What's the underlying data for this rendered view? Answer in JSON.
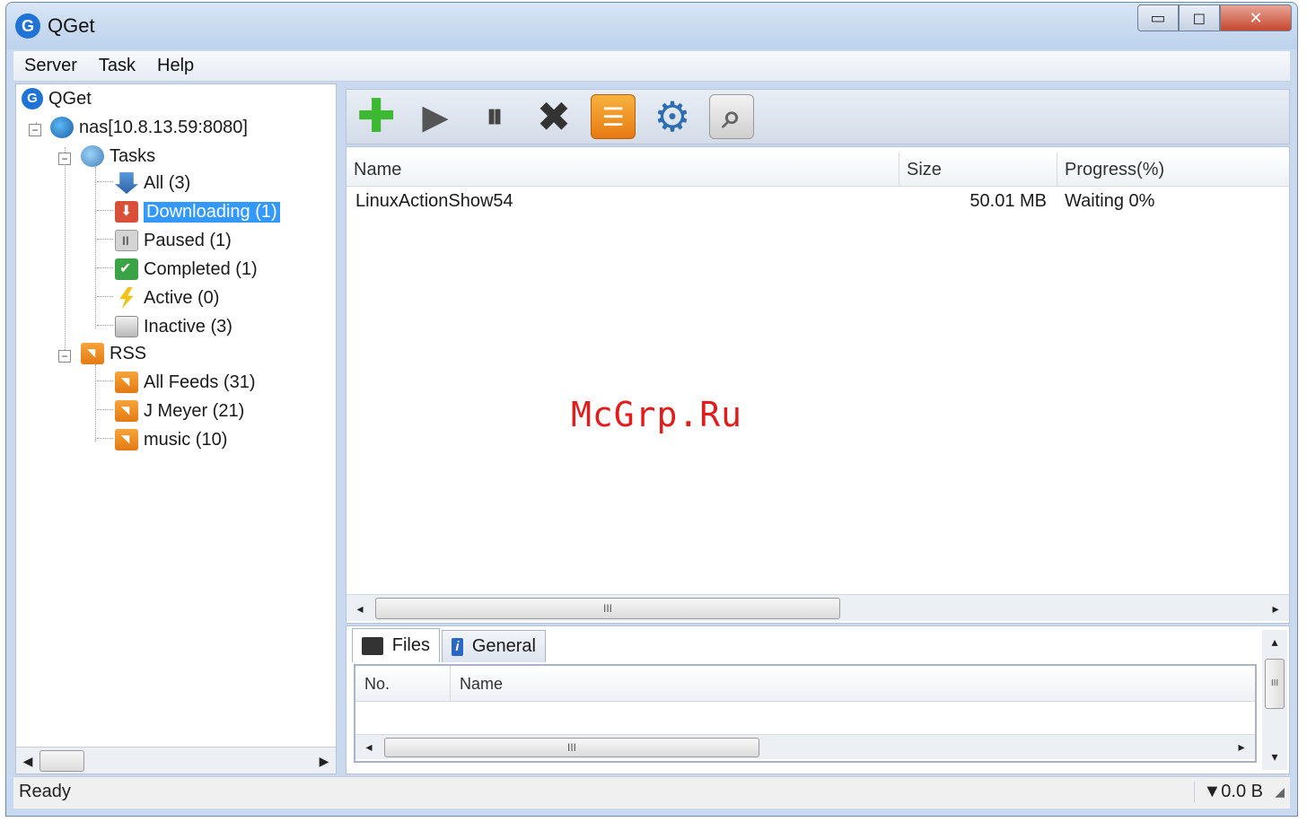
{
  "window": {
    "title": "QGet",
    "min_glyph": "▭",
    "max_glyph": "◻",
    "close_glyph": "✕"
  },
  "menu": [
    "Server",
    "Task",
    "Help"
  ],
  "tree": {
    "root": "QGet",
    "server": "nas[10.8.13.59:8080]",
    "tasks": "Tasks",
    "task_items": [
      {
        "label": "All (3)",
        "icon": "download-all-icon"
      },
      {
        "label": "Downloading (1)",
        "icon": "downloading-icon",
        "selected": true
      },
      {
        "label": "Paused (1)",
        "icon": "paused-icon"
      },
      {
        "label": "Completed (1)",
        "icon": "completed-icon"
      },
      {
        "label": "Active (0)",
        "icon": "active-icon"
      },
      {
        "label": "Inactive (3)",
        "icon": "inactive-icon"
      }
    ],
    "rss": "RSS",
    "rss_items": [
      {
        "label": "All Feeds (31)",
        "icon": "rss-icon"
      },
      {
        "label": "J Meyer (21)",
        "icon": "rss-icon"
      },
      {
        "label": "music (10)",
        "icon": "rss-icon"
      }
    ]
  },
  "toolbar": {
    "buttons": [
      {
        "name": "add-task-button",
        "glyph": "✚"
      },
      {
        "name": "start-button",
        "glyph": "▶"
      },
      {
        "name": "pause-button",
        "glyph": "⏸"
      },
      {
        "name": "delete-button",
        "glyph": "✖"
      },
      {
        "name": "task-list-button",
        "glyph": "☰"
      },
      {
        "name": "settings-button",
        "glyph": "⚙"
      },
      {
        "name": "search-button",
        "glyph": "⌕"
      }
    ]
  },
  "list": {
    "columns": [
      "Name",
      "Size",
      "Progress(%)"
    ],
    "rows": [
      {
        "name": "LinuxActionShow54",
        "size": "50.01 MB",
        "progress": "Waiting 0%"
      }
    ]
  },
  "detail": {
    "tabs": [
      "Files",
      "General"
    ],
    "info_glyph": "i",
    "columns": [
      "No.",
      "Name"
    ]
  },
  "scrollbars": {
    "grip": "III",
    "left": "◂",
    "right": "▸",
    "up": "▴",
    "down": "▾",
    "left_solid": "◀",
    "right_solid": "▶"
  },
  "tree_expander": "−",
  "status": {
    "text": "Ready",
    "speed": "▼0.0 B",
    "resize_glyph": "◢"
  },
  "watermark": "McGrp.Ru"
}
